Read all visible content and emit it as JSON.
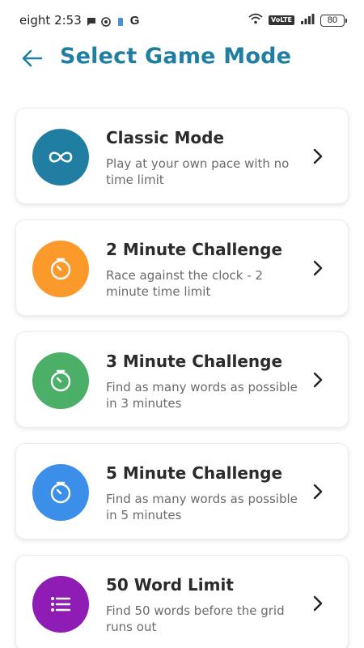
{
  "status_bar": {
    "time": "eight 2:53",
    "g_label": "G",
    "volte": "VoLTE",
    "battery": "80"
  },
  "header": {
    "title": "Select Game Mode"
  },
  "modes": [
    {
      "title": "Classic Mode",
      "description": "Play at your own pace with no time limit",
      "icon": "infinity-icon",
      "color": "#1f7ea1"
    },
    {
      "title": "2 Minute Challenge",
      "description": "Race against the clock - 2 minute time limit",
      "icon": "timer-icon",
      "color": "#fb9a2b"
    },
    {
      "title": "3 Minute Challenge",
      "description": "Find as many words as possible in 3 minutes",
      "icon": "timer-icon",
      "color": "#4caf68"
    },
    {
      "title": "5 Minute Challenge",
      "description": "Find as many words as possible in 5 minutes",
      "icon": "timer-icon",
      "color": "#3b8fe8"
    },
    {
      "title": "50 Word Limit",
      "description": "Find 50 words before the grid runs out",
      "icon": "list-icon",
      "color": "#8e1cb5"
    }
  ]
}
